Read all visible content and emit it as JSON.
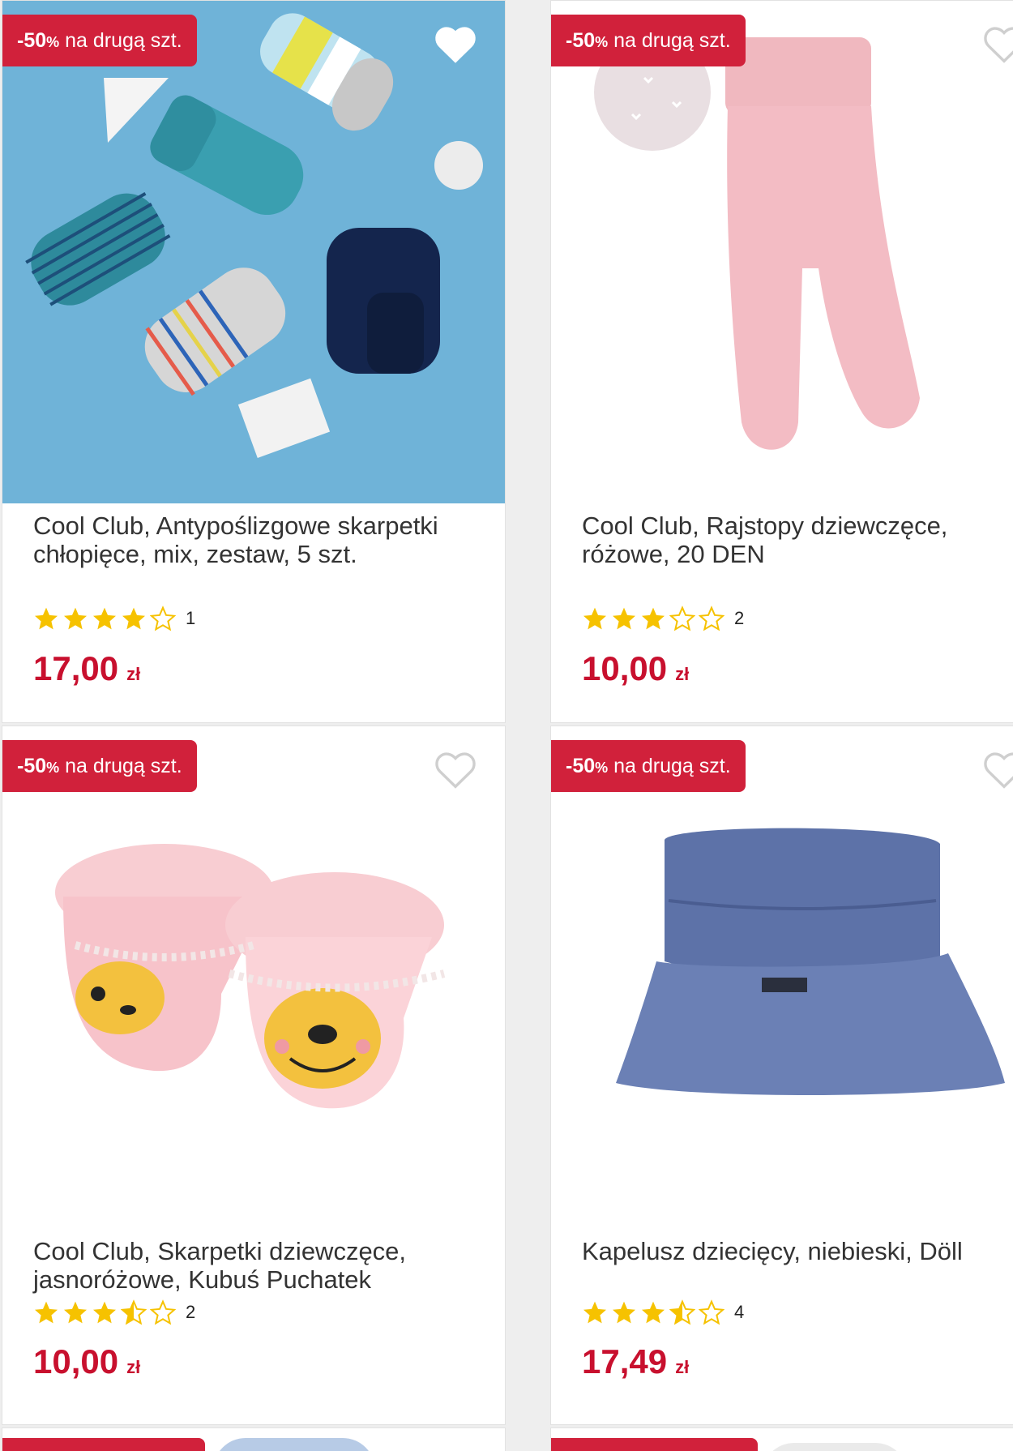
{
  "badge": {
    "percent": "-50%",
    "text": "na drugą szt."
  },
  "colors": {
    "accent": "#d1213b",
    "price": "#c8102e",
    "star": "#f6c200"
  },
  "products": [
    {
      "title": "Cool Club, Antypoślizgowe skarpetki chłopięce, mix, zestaw, 5 szt.",
      "rating": 4,
      "rating_count": "1",
      "price": "17,00",
      "currency": "zł",
      "favorited": true,
      "image": "socks-set-blue-background"
    },
    {
      "title": "Cool Club, Rajstopy dziewczęce, różowe, 20 DEN",
      "rating": 3,
      "rating_count": "2",
      "price": "10,00",
      "currency": "zł",
      "favorited": false,
      "image": "pink-tights"
    },
    {
      "title": "Cool Club, Skarpetki dziewczęce, jasnoróżowe, Kubuś Puchatek",
      "rating": 3.5,
      "rating_count": "2",
      "price": "10,00",
      "currency": "zł",
      "favorited": false,
      "image": "pink-baby-socks-pooh"
    },
    {
      "title": "Kapelusz dziecięcy, niebieski, Döll",
      "rating": 3.5,
      "rating_count": "4",
      "price": "17,49",
      "currency": "zł",
      "favorited": false,
      "image": "blue-bucket-hat"
    }
  ]
}
